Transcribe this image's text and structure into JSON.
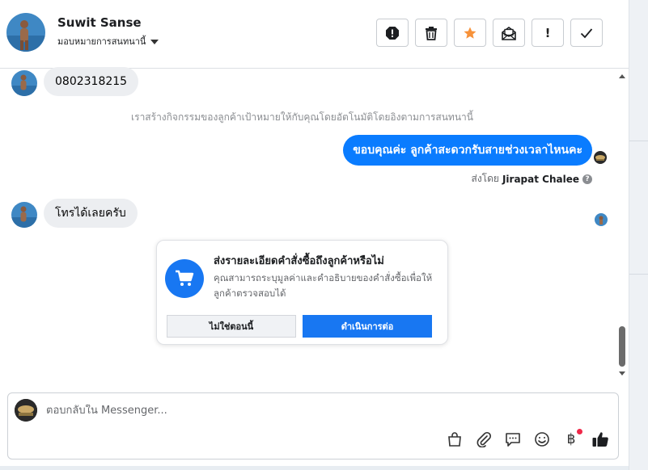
{
  "header": {
    "contact_name": "Suwit Sanse",
    "assignment_label": "มอบหมายการสนทนานี้",
    "tools": [
      "report-icon",
      "trash-icon",
      "star-icon",
      "mark-unread-icon",
      "follow-up-icon",
      "done-icon"
    ],
    "follow_up_glyph": "!"
  },
  "conversation": {
    "phone_message": "0802318215",
    "system_note": "เราสร้างกิจกรรมของลูกค้าเป้าหมายให้กับคุณโดยอัตโนมัติโดยอิงตามการสนทนานี้",
    "outgoing_message": "ขอบคุณค่ะ ลูกค้าสะดวกรับสายช่วงเวลาไหนคะ",
    "sent_by_prefix": "ส่งโดย",
    "sent_by_name": "Jirapat Chalee",
    "help_glyph": "?",
    "incoming_message": "โทรได้เลยครับ"
  },
  "order_card": {
    "title": "ส่งรายละเอียดคำสั่งซื้อถึงลูกค้าหรือไม่",
    "description": "คุณสามารถระบุมูลค่าและคำอธิบายของคำสั่งซื้อเพื่อให้ลูกค้าตรวจสอบได้",
    "dismiss_label": "ไม่ใช่ตอนนี้",
    "continue_label": "ดำเนินการต่อ"
  },
  "composer": {
    "placeholder": "ตอบกลับใน Messenger...",
    "icons": [
      "shopping-bag-icon",
      "paperclip-icon",
      "saved-reply-icon",
      "emoji-icon",
      "payment-icon",
      "like-icon"
    ],
    "payment_glyph": "฿"
  },
  "colors": {
    "accent": "#1877f2",
    "outgoing_bubble": "#0a7cff",
    "incoming_bubble": "#eceef1",
    "star": "#f7923a",
    "notification_dot": "#f02849"
  }
}
